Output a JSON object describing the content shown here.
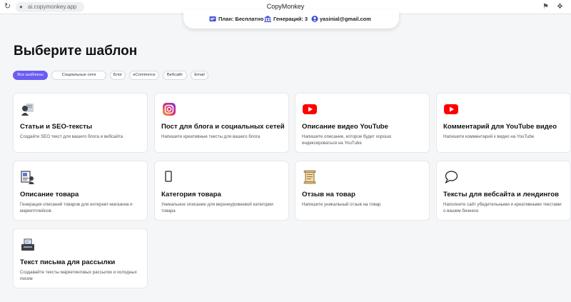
{
  "browser": {
    "url": "ai.copymonkey.app",
    "title": "CopyMonkey",
    "reload_icon": "reload-icon",
    "lock_icon": "lock-icon"
  },
  "user_bar": {
    "plan": "План: Бесплатно",
    "generations": "Генераций: 3",
    "email": "yasinial@gmail.com"
  },
  "page": {
    "title": "Выберите шаблон"
  },
  "filters": [
    {
      "label": "Все шаблоны",
      "active": true
    },
    {
      "label": "Социальные сети",
      "active": false
    },
    {
      "label": "Блог",
      "active": false
    },
    {
      "label": "eCommerce",
      "active": false
    },
    {
      "label": "Вебсайт",
      "active": false
    },
    {
      "label": "Email",
      "active": false
    }
  ],
  "cards": [
    {
      "title": "Статьи и SEO-тексты",
      "desc": "Создайте SEO текст для вашего блога и вебсайта",
      "icon": "writer-icon"
    },
    {
      "title": "Пост для блога и социальных сетей",
      "desc": "Напишите креативные тексты для вашего блога",
      "icon": "instagram-icon"
    },
    {
      "title": "Описание видео YouTube",
      "desc": "Напишите описание, которое будет хорошо индексироваться на YouTube",
      "icon": "youtube-icon"
    },
    {
      "title": "Комментарий для YouTube видео",
      "desc": "Напишите комментарий к видео на YouTube",
      "icon": "youtube-icon"
    },
    {
      "title": "Описание товара",
      "desc": "Генерация описаний товаров для интернет-магазина и маркетплейсов",
      "icon": "product-icon"
    },
    {
      "title": "Категория товара",
      "desc": "Уникальное описание для верхнеуровневой категории товара",
      "icon": "phone-icon"
    },
    {
      "title": "Отзыв на товар",
      "desc": "Напишите уникальный отзыв на товар",
      "icon": "scroll-icon"
    },
    {
      "title": "Тексты для вебсайта и лендингов",
      "desc": "Наполните сайт убедительными и креативными текстами о вашем бизнесе",
      "icon": "speech-bubble-icon"
    },
    {
      "title": "Текст письма для рассылки",
      "desc": "Создавайте тексты маркетинговых рассылок и холодных писем",
      "icon": "mail-print-icon"
    }
  ],
  "colors": {
    "accent": "#6b5cf5",
    "youtube_red": "#ff0000",
    "background": "#f5f6f8"
  }
}
